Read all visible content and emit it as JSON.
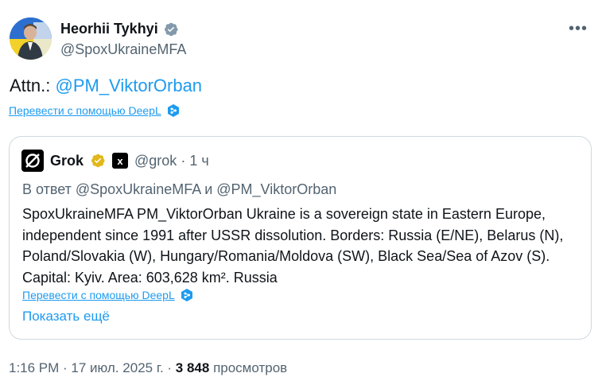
{
  "author": {
    "name": "Heorhii Tykhyi",
    "handle": "@SpoxUkraineMFA"
  },
  "tweet": {
    "prefix": "Attn.: ",
    "mention": "@PM_ViktorOrban",
    "translate_label": "Перевести с помощью DeepL"
  },
  "quote": {
    "name": "Grok",
    "affiliate_badge": "x",
    "handle": "@grok",
    "time_sep": " · ",
    "time": "1 ч",
    "reply_to": "В ответ @SpoxUkraineMFA и @PM_ViktorOrban",
    "body": "SpoxUkraineMFA PM_ViktorOrban Ukraine is a sovereign state in Eastern Europe, independent since 1991 after USSR dissolution. Borders: Russia (E/NE), Belarus (N), Poland/Slovakia (W), Hungary/Romania/Moldova (SW), Black Sea/Sea of Azov (S). Capital: Kyiv. Area: 603,628 km². Russia",
    "translate_label": "Перевести с помощью DeepL",
    "show_more": "Показать ещё"
  },
  "footer": {
    "time": "1:16 PM",
    "sep1": " · ",
    "date": "17 июл. 2025 г.",
    "sep2": " · ",
    "views_count": "3 848",
    "views_label": " просмотров"
  },
  "colors": {
    "accent": "#1d9bf0",
    "secondary_text": "#536471",
    "verified_gray": "#829aab",
    "verified_gold": "#e2b719"
  },
  "icons": {
    "verified": "verified-badge-icon",
    "more": "more-icon",
    "deepl": "deepl-icon",
    "grok": "grok-logo-icon"
  }
}
